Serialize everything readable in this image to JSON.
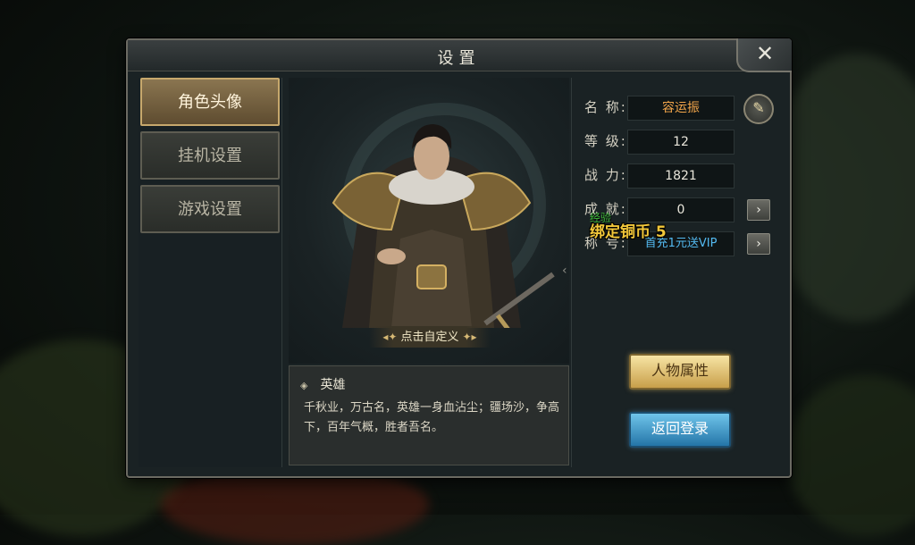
{
  "window": {
    "title": "设置",
    "close_icon": "✕"
  },
  "tabs": [
    {
      "label": "角色头像",
      "active": true
    },
    {
      "label": "挂机设置",
      "active": false
    },
    {
      "label": "游戏设置",
      "active": false
    }
  ],
  "portrait": {
    "custom_label": "点击自定义",
    "deco_left": "◂✦",
    "deco_right": "✦▸"
  },
  "description": {
    "bullet": "◈",
    "title": "英雄",
    "text": "千秋业，万古名，英雄一身血沾尘；疆场沙，争高下，百年气概，胜者吾名。"
  },
  "info": {
    "name_label": "名 称:",
    "name_value": "容运振",
    "level_label": "等 级:",
    "level_value": "12",
    "power_label": "战 力:",
    "power_value": "1821",
    "achievement_label": "成 就:",
    "achievement_value": "0",
    "title_label": "称 号:",
    "title_value": "首充1元送VIP",
    "arrow": "›",
    "edit_icon": "✎"
  },
  "floating": {
    "exp": "经验",
    "reward": "绑定铜币 5"
  },
  "buttons": {
    "attributes": "人物属性",
    "back_login": "返回登录"
  },
  "colors": {
    "gold": "#c89f4a",
    "blue": "#2475a8",
    "name": "#f2a54a",
    "title_blue": "#53b9f0"
  }
}
